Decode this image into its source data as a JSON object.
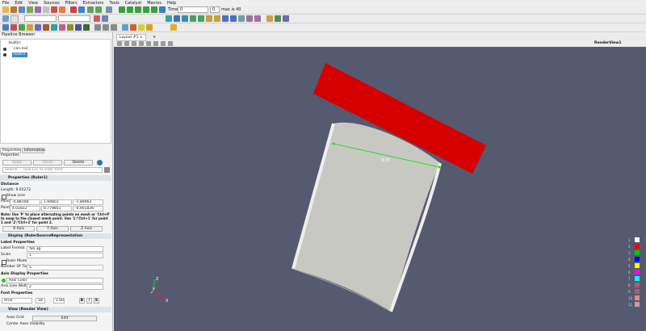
{
  "menu": [
    "File",
    "Edit",
    "View",
    "Sources",
    "Filters",
    "Extractors",
    "Tools",
    "Catalyst",
    "Macros",
    "Help"
  ],
  "toolbar": {
    "time_label": "Time:",
    "time_value": "0",
    "timestep_value": "0",
    "max_label": "max is 40"
  },
  "pipeline": {
    "title": "Pipeline Browser",
    "items": [
      "builtin:",
      "can.ex2",
      "Ruler1"
    ]
  },
  "tabs": [
    "Properties",
    "Information"
  ],
  "properties": {
    "title": "Properties",
    "apply": "Apply",
    "reset": "Reset",
    "delete": "Delete",
    "search_placeholder": "Search ... (use Esc to clear text)",
    "section_ruler": "Properties (Ruler1)",
    "distance_heading": "Distance",
    "length_text": "Length: 9.05272",
    "show_line": "Show Line",
    "point1_label": "Point1",
    "point1": [
      "-4.88108",
      "1.94803",
      "-1.89063"
    ],
    "point2_label": "Point2",
    "point2": [
      "4.01812",
      "0.779851",
      "-0.901826"
    ],
    "note": "Note: Use 'P' to place alternating points on mesh or 'Ctrl+P' to snap to the closest mesh point. Use '1'/'Ctrl+1' for point 1 and '2'/'Ctrl+2' for point 2.",
    "x_axis": "X Axis",
    "y_axis": "Y Axis",
    "z_axis": "Z Axis",
    "section_display": "Display (RulerSourceRepresentation",
    "label_props": "Label Properties",
    "label_format_label": "Label Format",
    "label_format": "%6.3g",
    "scale_label": "Scale",
    "scale_value": "1",
    "ruler_mode": "Ruler Mode",
    "ticks_label": "Number Of Ticks",
    "ticks_value": "5",
    "axis_display": "Axis Display Properties",
    "axis_color": "Axis Color",
    "axis_line_width_label": "Axis Line Width",
    "axis_line_width": "2",
    "font_props": "Font Properties",
    "font_family": "Arial",
    "font_size": "18",
    "opacity": "1.00",
    "bold": "B",
    "italic": "I",
    "shadow": "S",
    "section_view": "View (Render View)",
    "axes_grid": "Axes Grid",
    "axes_grid_btn": "Edit",
    "center_axes": "Center Axes Visibility"
  },
  "view": {
    "tab_label": "Layout #1",
    "close": "×",
    "add": "+",
    "render_view": "RenderView1",
    "measure_label": "9.05",
    "background": "#555a70",
    "ruler_color": "#22dd22"
  },
  "legend": {
    "labels": [
      "1",
      "2",
      "3",
      "4",
      "5",
      "6",
      "7",
      "8",
      "9",
      "10",
      "11"
    ],
    "colors": [
      "#ffffff",
      "#ff0000",
      "#00c800",
      "#0000ff",
      "#ffff00",
      "#ff00ff",
      "#00ffff",
      "#b06060",
      "#a06080",
      "#ff8080",
      "#c8a0a0"
    ]
  },
  "axes": {
    "z": "Z",
    "y": "Y",
    "x": "X"
  }
}
